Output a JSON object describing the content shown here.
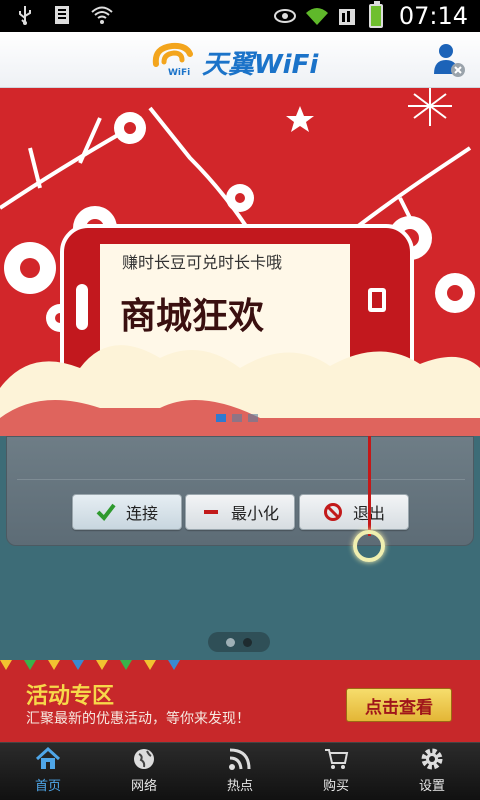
{
  "status_bar": {
    "time": "07:14",
    "icons_left": [
      "usb-icon",
      "sim-icon",
      "wifi-question-icon"
    ],
    "icons_right": [
      "eye-icon",
      "wifi-icon",
      "signal-icon",
      "battery-icon"
    ]
  },
  "header": {
    "logo_text": "天翼WiFi",
    "logo_sub": "WiFi",
    "user_icon": "user-remove-icon"
  },
  "banner": {
    "top_line": "赚时长豆可兑时长卡哦",
    "main_text": "商城狂欢",
    "slides_count": 3,
    "active_slide": 0
  },
  "controls": {
    "connect_label": "连接",
    "minimize_label": "最小化",
    "exit_label": "退出"
  },
  "pager": {
    "count": 2,
    "active": 1
  },
  "activity": {
    "title": "活动专区",
    "description": "汇聚最新的优惠活动，等你来发现！",
    "button_label": "点击查看"
  },
  "tabs": [
    {
      "label": "首页",
      "icon": "home-icon",
      "active": true
    },
    {
      "label": "网络",
      "icon": "globe-icon",
      "active": false
    },
    {
      "label": "热点",
      "icon": "hotspot-icon",
      "active": false
    },
    {
      "label": "购买",
      "icon": "cart-icon",
      "active": false
    },
    {
      "label": "设置",
      "icon": "gear-icon",
      "active": false
    }
  ],
  "colors": {
    "accent": "#4fa6e8",
    "banner_red": "#d42a2a",
    "app_bg": "#3d6c77"
  }
}
